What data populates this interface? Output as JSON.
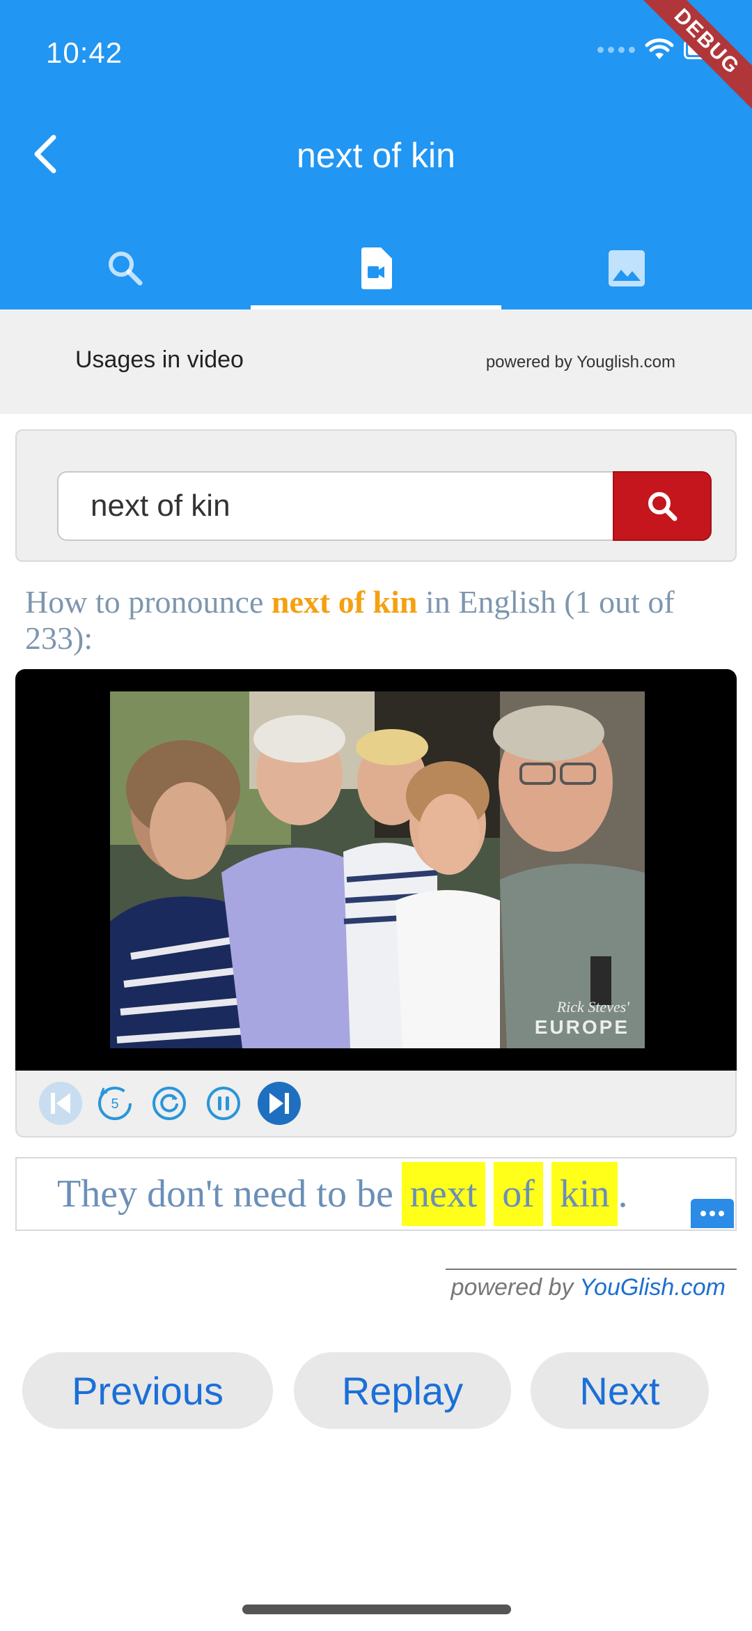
{
  "status_bar": {
    "time": "10:42",
    "debug_label": "DEBUG"
  },
  "app_bar": {
    "title": "next of kin",
    "tabs": [
      {
        "icon": "search-icon",
        "active": false
      },
      {
        "icon": "video-file-icon",
        "active": true
      },
      {
        "icon": "image-icon",
        "active": false
      }
    ]
  },
  "usage_header": {
    "title": "Usages in video",
    "powered": "powered by Youglish.com"
  },
  "search": {
    "value": "next of kin",
    "button_icon": "search-icon"
  },
  "pronounce": {
    "prefix": "How to pronounce ",
    "term": "next of kin",
    "suffix": " in English (1 out of 233):"
  },
  "video": {
    "watermark_signature": "Rick Steves'",
    "watermark_brand": "EUROPE"
  },
  "controls": {
    "buttons": [
      "skip-previous-icon",
      "replay-5-icon",
      "reload-icon",
      "pause-icon",
      "skip-next-icon"
    ]
  },
  "caption": {
    "prefix": "They don't need to be",
    "highlighted": [
      "next",
      "of",
      "kin"
    ],
    "suffix": "."
  },
  "powered_by": {
    "prefix": "powered by ",
    "brand": "YouGlish.com"
  },
  "buttons": {
    "previous": "Previous",
    "replay": "Replay",
    "next": "Next"
  },
  "colors": {
    "app_bar": "#2196F3",
    "search_button": "#C4161C",
    "term_highlight": "#F5A011",
    "caption_highlight": "#FFFF1A",
    "button_text": "#1B6FD8"
  }
}
